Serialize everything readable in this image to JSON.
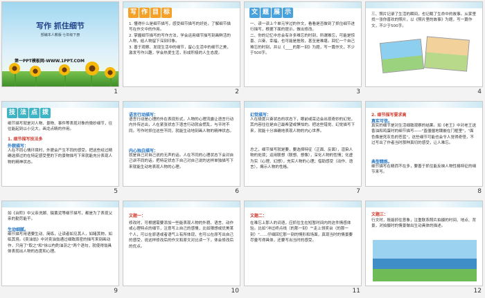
{
  "slides": [
    {
      "num": "1",
      "title": "写作   抓住细节",
      "byline": "部编本人教版·七年级下册",
      "site": "第一PPT模板网-WWW.1PPT.COM"
    },
    {
      "num": "2",
      "tag": [
        "写",
        "作",
        "目",
        "标"
      ],
      "text": "1. 懂得什么是细节描写，感受细节描写的好处，了解细节描写在作文中的作用。\n2. 掌握细节描写的写作方法，学会运用细节描写刻画鲜活的人物，给人物留下深刻印象。\n3. 善于观察、发现生活中的细节，留心生活中的细节之美，激发写作兴趣，学会热爱生活，形成积极的人生态度。"
    },
    {
      "num": "3",
      "tag": [
        "文",
        "题",
        "展",
        "示"
      ],
      "text": "一、读一读上个单元学过的作文，看看是否做到了抓住细节进行描写，根据下面的提示，做出修改。\n二、你的记忆中总会有许多难忘的时刻，所谓难忘，可能是惊喜、兴奋、幸福，也可能是挫败，甚至是难堪。回忆一个自己难忘的时刻，并以《____的那一刻》为题，写一篇作文，不少于500字。"
    },
    {
      "num": "4",
      "text": "三、照片记录了生活的瞬间，也记载了生命中的故事。从家里找一张你喜欢的照片，以《照片里的故事》为题，写一篇作文，不少于500字。"
    },
    {
      "num": "5",
      "tag": [
        "技",
        "法",
        "点",
        "拨"
      ],
      "text": "细节描写就是对人物、景物、事件等表现对象的微妙细节，往往能起到以小见大，画龙点睛的作用。",
      "heading": "1. 细节描写技法多",
      "sub": "外貌描写：",
      "text2": "人在不同心情环境时，外貌会产生不同的感受。把这些经过精确选择过的在特定感受里的下的景物描写下来就能充分表现人物的精神状态。"
    },
    {
      "num": "6",
      "sub": "语言行动描写：",
      "text": "语言行动是心理的外在表现形式，人物的心理流露让语言行动内外传达出，人在紧张状态下语言行动就会慌乱，与平时不同。写作时抓住这些不同，就能生动地刻画人物的精神状态。",
      "sub2": "内心独白描写：",
      "text2": "就是自己对自己说的无声的话。人在不同的心理状态下会对自己讲不同的话。把特定状态下自己对自己说的这样单独描写下来就能生动地表现人物的心理。"
    },
    {
      "num": "7",
      "sub": "幻觉描写：",
      "text": "人在极度兴奋状态的状态下，眼前或耳边会出现奇妙的幻觉，其内容往往是自己最希望或惧怕的。把这些错觉、幻觉描写下来，就能十分准确地表现人物的内心世界。",
      "text2": "总之，细节描写就是要，要选择特征（正面、反面），渲染人物的处境；运用联想（联想、想像），深化人物的性情；化虚为实（心理、幻想），充实人物的心理；借助感受（动作、语言），揭示人物的性格。"
    },
    {
      "num": "8",
      "heading": "2. 细节描写要求高",
      "sub": "真实可信。",
      "text": "真实的细节是对生活细致观察的结果。如《老王》中对老王送香油和鸡蛋时的细节描写——\"直僵僵地镶嵌在门框里\"，\"面色像是死灰色的苍蓝\"，这些细节可能也会令人觉得奇怪，不过写出了作者当时那种真切的感受，让人难忘。",
      "sub2": "典型精炼。",
      "text2": "细节描写在精而不在多，要善于抓住能反映人物性格特征的细节来写。"
    },
    {
      "num": "9",
      "text": "如《台阶》中父亲洗脚、辍黄泥等细节描写，都是为了表现父亲的勤劳能干。",
      "sub": "生动细腻。",
      "text2": "细节描写用语要生动、简练，让读者如见其人，如睹其物，如临其境。《卖油翁》中对卖油翁通过细致周密的描写来刻画动作，只用了\"取之\"和\"徐以杓酌油沥之\"两个语句，就使得翁具体表现出人物的态度和心理。"
    },
    {
      "num": "10",
      "heading": "文题一：",
      "text": "修改时，可根据需要添加一些能表现人物的外貌、语言、动作或心理特点的细节，注意写上自己的感情，比如猜想或优美某个人，可以在原语或者语气上有所体现，也可以在原写出自己的感受，说这样修改后的作文和原文对比读一下，体会修改后的优点。"
    },
    {
      "num": "11",
      "heading": "文题二：",
      "text": "在难忘上那人的词语，应抓住生在短暂时间内的这件情感体验。比如\"冲过终点线（的那一刻）\"\"走上领奖台（的那一刻）\"……仔细回忆那一刻的情形和场面，真现当时的情景要尽量写得具体，还要写出当时的感受。"
    },
    {
      "num": "12",
      "heading": "文题三：",
      "text": "行文时，既能抓住意象，注重联系照片拍摄的时间、地点、背景，对拍摄时的情景做出生动具体的描述。"
    }
  ],
  "colors": {
    "tag_orange": "#f4a12a",
    "tag_blue": "#4aa2dc",
    "heading_red": "#d13b2f",
    "sub_blue": "#2273c4"
  }
}
